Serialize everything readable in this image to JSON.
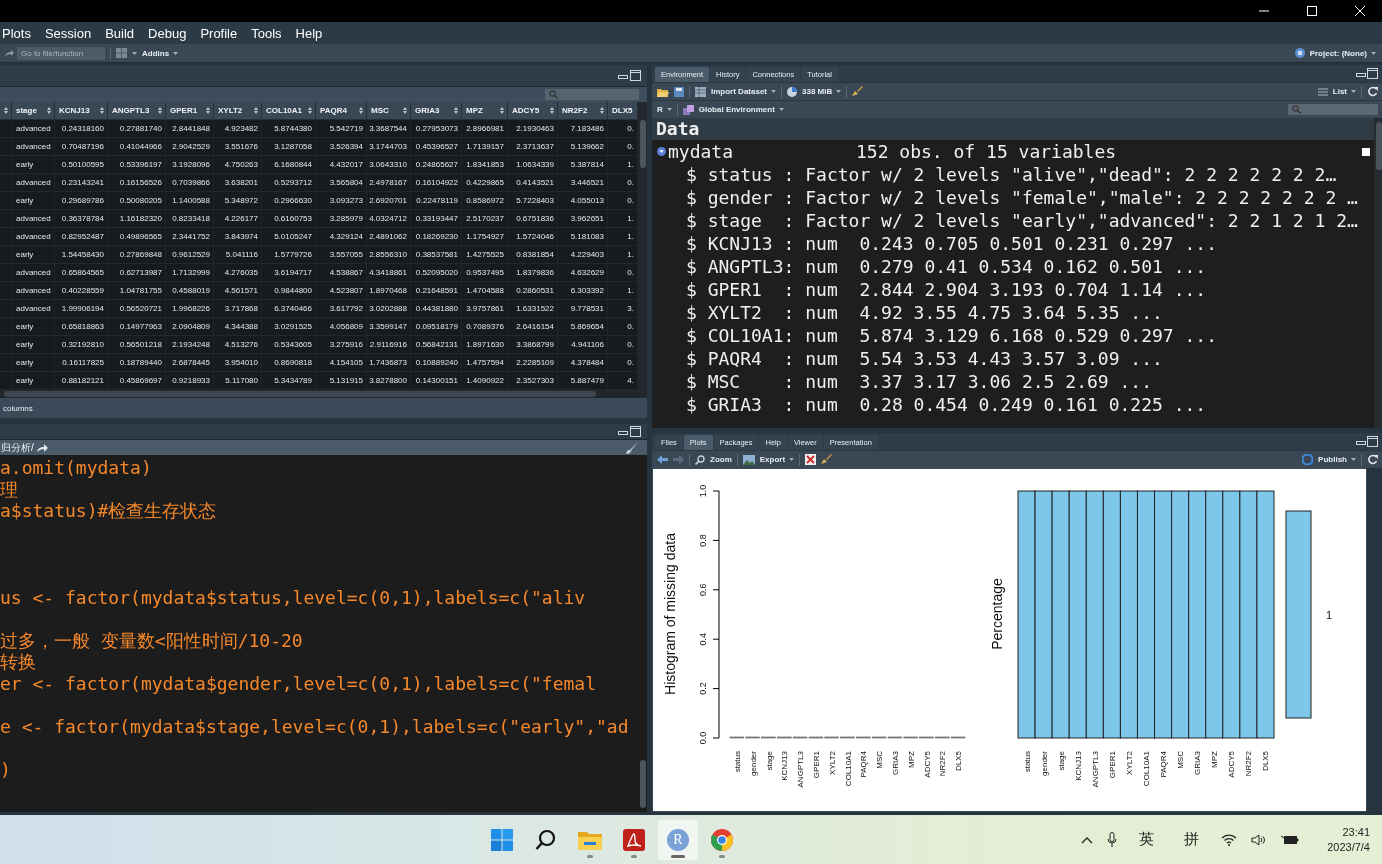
{
  "menu": {
    "items": [
      "Plots",
      "Session",
      "Build",
      "Debug",
      "Profile",
      "Tools",
      "Help"
    ]
  },
  "toolbar": {
    "goto_placeholder": "Go to file/function",
    "addins": "Addins",
    "project": "Project: (None)"
  },
  "data_viewer": {
    "columns": [
      "stage",
      "KCNJ13",
      "ANGPTL3",
      "GPER1",
      "XYLT2",
      "COL10A1",
      "PAQR4",
      "MSC",
      "GRIA3",
      "MPZ",
      "ADCY5",
      "NR2F2",
      "DLX5"
    ],
    "rows": [
      [
        "advanced",
        "0.24318160",
        "0.27881740",
        "2.8441848",
        "4.923482",
        "5.8744380",
        "5.542719",
        "3.3687544",
        "0.27953073",
        "2.8966981",
        "2.1930463",
        "7.183486",
        "0."
      ],
      [
        "advanced",
        "0.70487196",
        "0.41044966",
        "2.9042529",
        "3.551676",
        "3.1287058",
        "3.526394",
        "3.1744703",
        "0.45396527",
        "1.7139157",
        "2.3713637",
        "5.139662",
        "0."
      ],
      [
        "early",
        "0.50100595",
        "0.53396197",
        "3.1928096",
        "4.750263",
        "6.1680844",
        "4.432017",
        "3.0643310",
        "0.24865627",
        "1.8341853",
        "1.0634339",
        "5.387814",
        "1."
      ],
      [
        "advanced",
        "0.23143241",
        "0.16156526",
        "0.7039866",
        "3.638201",
        "0.5293712",
        "3.565804",
        "2.4978167",
        "0.16104922",
        "0.4229865",
        "0.4143521",
        "3.446521",
        "0."
      ],
      [
        "early",
        "0.29689786",
        "0.50080205",
        "1.1400588",
        "5.348972",
        "0.2966630",
        "3.093273",
        "2.6920701",
        "0.22478119",
        "0.8586972",
        "5.7228403",
        "4.055013",
        "0."
      ],
      [
        "advanced",
        "0.36378784",
        "1.16182320",
        "0.8233418",
        "4.226177",
        "0.6160753",
        "3.285979",
        "4.0324712",
        "0.33193447",
        "2.5170237",
        "0.6751836",
        "3.962651",
        "1."
      ],
      [
        "advanced",
        "0.82952487",
        "0.49896565",
        "2.3441752",
        "3.843974",
        "5.0105247",
        "4.329124",
        "2.4891062",
        "0.18269230",
        "1.1754927",
        "1.5724046",
        "5.181083",
        "1."
      ],
      [
        "early",
        "1.54458430",
        "0.27869848",
        "0.9612529",
        "5.041116",
        "1.5779726",
        "3.557055",
        "2.8556310",
        "0.38537581",
        "1.4275525",
        "0.8381854",
        "4.229403",
        "1."
      ],
      [
        "advanced",
        "0.65864565",
        "0.62713987",
        "1.7132999",
        "4.276035",
        "3.6194717",
        "4.538867",
        "4.3418861",
        "0.52095020",
        "0.9537495",
        "1.8379836",
        "4.632629",
        "0."
      ],
      [
        "advanced",
        "0.40228559",
        "1.04781755",
        "0.4588019",
        "4.561571",
        "0.9844800",
        "4.523807",
        "1.8970468",
        "0.21648591",
        "1.4704588",
        "0.2860531",
        "6.303392",
        "1."
      ],
      [
        "advanced",
        "1.99906194",
        "0.56520721",
        "1.9968226",
        "3.717868",
        "6.3740466",
        "3.617792",
        "3.0202888",
        "0.44381880",
        "3.9757861",
        "1.6331522",
        "9.778531",
        "3."
      ],
      [
        "early",
        "0.65818863",
        "0.14977963",
        "2.0904809",
        "4.344388",
        "3.0291525",
        "4.056809",
        "3.3599147",
        "0.09518179",
        "0.7089376",
        "2.6416154",
        "5.869654",
        "0."
      ],
      [
        "early",
        "0.32192810",
        "0.56501218",
        "2.1934248",
        "4.513276",
        "0.5343605",
        "3.275916",
        "2.9116916",
        "0.56842131",
        "1.8971630",
        "3.3868799",
        "4.941106",
        "0."
      ],
      [
        "early",
        "0.16117825",
        "0.18789440",
        "2.6878445",
        "3.954010",
        "0.8690818",
        "4.154105",
        "1.7436873",
        "0.10889240",
        "1.4757594",
        "2.2285109",
        "4.378484",
        "0."
      ],
      [
        "early",
        "0.88182121",
        "0.45869697",
        "0.9218933",
        "5.117080",
        "5.3434789",
        "5.131915",
        "3.8278800",
        "0.14300151",
        "1.4090922",
        "2.3527303",
        "5.887479",
        "4."
      ]
    ],
    "footer": "columns"
  },
  "editor": {
    "path": "归分析/",
    "lines": [
      "a.omit(mydata)",
      "理",
      "a$status)#检查生存状态",
      "us <- factor(mydata$status,level=c(0,1),labels=c(\"aliv",
      "过多，一般 变量数<阳性时间/10-20",
      "转换",
      "er <- factor(mydata$gender,level=c(0,1),labels=c(\"femal",
      "e <- factor(mydata$stage,level=c(0,1),labels=c(\"early\",\"ad",
      ")"
    ]
  },
  "environment": {
    "tabs": [
      {
        "label": "Environment",
        "selected": true
      },
      {
        "label": "History",
        "selected": false
      },
      {
        "label": "Connections",
        "selected": false
      },
      {
        "label": "Tutorial",
        "selected": false
      }
    ],
    "import": "Import Dataset",
    "memory": "338 MiB",
    "view": "List",
    "language": "R",
    "scope": "Global Environment",
    "section": "Data",
    "object": {
      "name": "mydata",
      "summary": "152 obs. of 15 variables",
      "expanded": true
    },
    "fields": [
      "$ status : Factor w/ 2 levels \"alive\",\"dead\": 2 2 2 2 2 2 2…",
      "$ gender : Factor w/ 2 levels \"female\",\"male\": 2 2 2 2 2 2 2 …",
      "$ stage  : Factor w/ 2 levels \"early\",\"advanced\": 2 2 1 2 1 2…",
      "$ KCNJ13 : num  0.243 0.705 0.501 0.231 0.297 ...",
      "$ ANGPTL3: num  0.279 0.41 0.534 0.162 0.501 ...",
      "$ GPER1  : num  2.844 2.904 3.193 0.704 1.14 ...",
      "$ XYLT2  : num  4.92 3.55 4.75 3.64 5.35 ...",
      "$ COL10A1: num  5.874 3.129 6.168 0.529 0.297 ...",
      "$ PAQR4  : num  5.54 3.53 4.43 3.57 3.09 ...",
      "$ MSC    : num  3.37 3.17 3.06 2.5 2.69 ...",
      "$ GRIA3  : num  0.28 0.454 0.249 0.161 0.225 ..."
    ]
  },
  "plots": {
    "tabs": [
      {
        "label": "Files",
        "selected": false
      },
      {
        "label": "Plots",
        "selected": true
      },
      {
        "label": "Packages",
        "selected": false
      },
      {
        "label": "Help",
        "selected": false
      },
      {
        "label": "Viewer",
        "selected": false
      },
      {
        "label": "Presentation",
        "selected": false
      }
    ],
    "zoom": "Zoom",
    "export": "Export",
    "publish": "Publish",
    "left": {
      "chart_data": {
        "type": "bar",
        "ylabel": "Histogram of missing data",
        "categories": [
          "status",
          "gender",
          "stage",
          "KCNJ13",
          "ANGPTL3",
          "GPER1",
          "XYLT2",
          "COL10A1",
          "PAQR4",
          "MSC",
          "GRIA3",
          "MPZ",
          "ADCY5",
          "NR2F2",
          "DLX5"
        ],
        "values": [
          0,
          0,
          0,
          0,
          0,
          0,
          0,
          0,
          0,
          0,
          0,
          0,
          0,
          0,
          0
        ],
        "ylim": [
          0,
          1
        ],
        "yticks": [
          {
            "value": 0,
            "label": "0.0"
          },
          {
            "value": 0.2,
            "label": "0.2"
          },
          {
            "value": 0.4,
            "label": "0.4"
          },
          {
            "value": 0.6,
            "label": "0.6"
          },
          {
            "value": 0.8,
            "label": "0.8"
          },
          {
            "value": 1,
            "label": "1.0"
          }
        ]
      }
    },
    "right": {
      "ylabel": "Percentage",
      "categories": [
        "status",
        "gender",
        "stage",
        "KCNJ13",
        "ANGPTL3",
        "GPER1",
        "XYLT2",
        "COL10A1",
        "PAQR4",
        "MSC",
        "GRIA3",
        "MPZ",
        "ADCY5",
        "NR2F2",
        "DLX5"
      ],
      "legend_label": "1"
    }
  },
  "taskbar": {
    "apps": [
      {
        "kind": "start",
        "running": false,
        "selected": false
      },
      {
        "kind": "search",
        "running": false,
        "selected": false
      },
      {
        "kind": "folder",
        "running": true,
        "selected": false
      },
      {
        "kind": "pdf",
        "running": true,
        "selected": false
      },
      {
        "kind": "r",
        "label": "R",
        "running": true,
        "selected": true
      },
      {
        "kind": "chrome",
        "running": true,
        "selected": false
      }
    ],
    "ime": [
      "英",
      "拼"
    ],
    "time": "23:41",
    "date": "2023/7/4"
  }
}
